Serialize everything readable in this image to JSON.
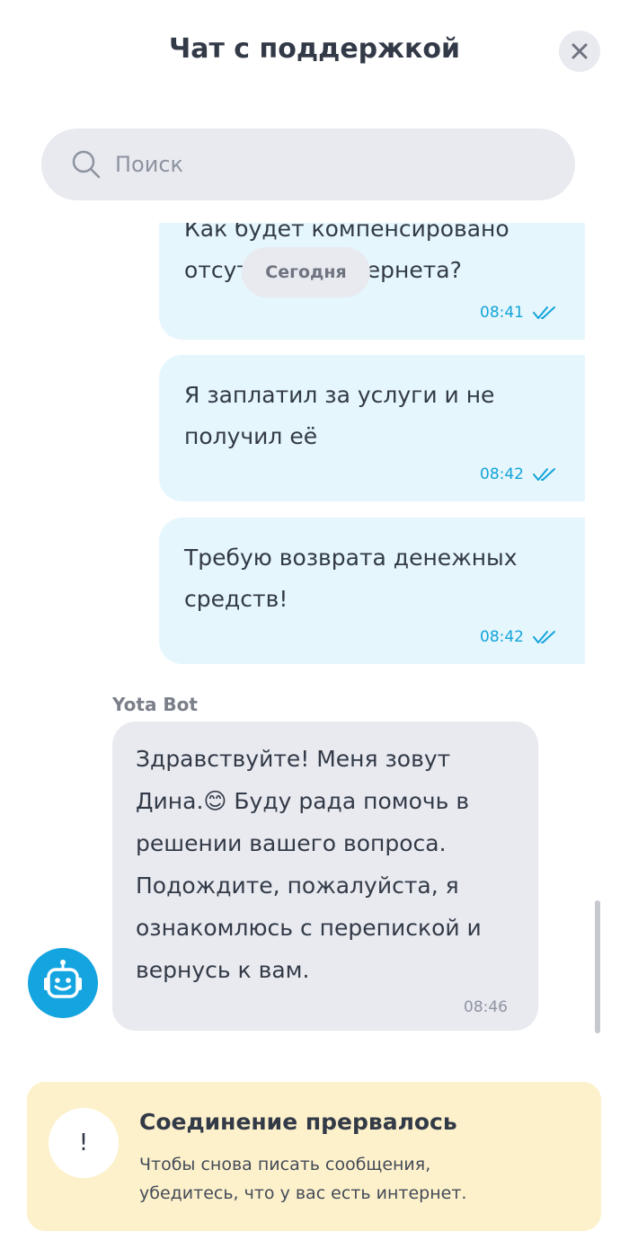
{
  "header": {
    "title": "Чат с поддержкой",
    "close_icon": "close-icon"
  },
  "search": {
    "placeholder": "Поиск",
    "value": "",
    "icon": "search-icon"
  },
  "date_chip": "Сегодня",
  "messages": [
    {
      "direction": "outgoing",
      "text": "Как будет компенсировано\nотсутствие интернета?",
      "time": "08:41",
      "status": "read"
    },
    {
      "direction": "outgoing",
      "text": "Я заплатил за услуги и не\nполучил её",
      "time": "08:42",
      "status": "read"
    },
    {
      "direction": "outgoing",
      "text": "Требую возврата денежных\nсредств!",
      "time": "08:42",
      "status": "read"
    },
    {
      "direction": "incoming",
      "sender": "Yota Bot",
      "text": "Здравствуйте! Меня зовут\nДина.😊 Буду рада помочь в\nрешении вашего вопроса.\nПодождите, пожалуйста, я\nознакомлюсь с перепиской и\nвернусь к вам.",
      "time": "08:46",
      "avatar_icon": "robot-icon"
    }
  ],
  "alert": {
    "icon": "exclamation-icon",
    "icon_glyph": "!",
    "title": "Соединение прервалось",
    "text": "Чтобы снова писать сообщения,\nубедитесь, что у вас есть интернет."
  },
  "colors": {
    "outgoing_bubble": "#e5f6fd",
    "incoming_bubble": "#e8eaf0",
    "accent": "#14a4d9",
    "alert_background": "#fdf1cc"
  }
}
